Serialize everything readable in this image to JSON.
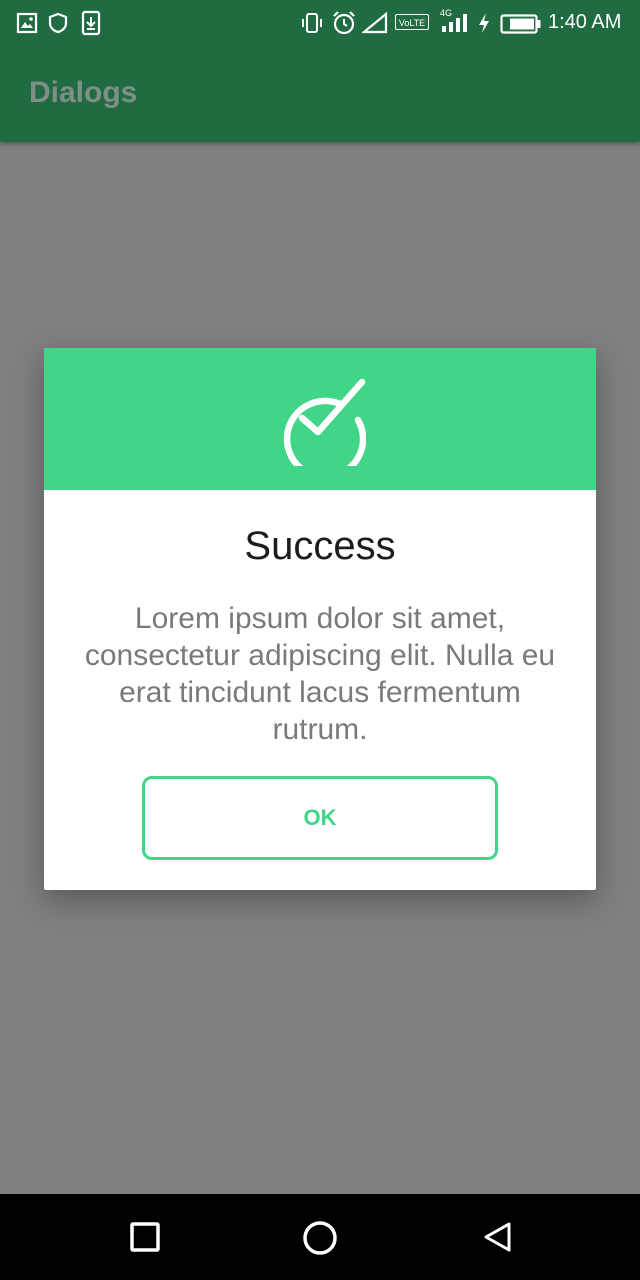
{
  "status_bar": {
    "time": "1:40 AM",
    "volte_label": "VoLTE",
    "network_label": "4G",
    "icons": [
      "image-icon",
      "shield-icon",
      "download-icon",
      "vibrate-icon",
      "alarm-icon",
      "signal-empty-icon",
      "volte-icon",
      "signal-4g-icon",
      "charging-icon",
      "battery-icon"
    ]
  },
  "app_bar": {
    "title": "Dialogs"
  },
  "dialog": {
    "icon": "check-circle-icon",
    "title": "Success",
    "message": "Lorem ipsum dolor sit amet, consectetur adipiscing elit. Nulla eu erat tincidunt lacus fermentum rutrum.",
    "button_label": "OK"
  },
  "nav_bar": {
    "icons": [
      "recents-square-icon",
      "home-circle-icon",
      "back-triangle-icon"
    ]
  },
  "colors": {
    "app_bar": "#216b43",
    "accent": "#40d587",
    "scrim": "#7f7f7f"
  }
}
